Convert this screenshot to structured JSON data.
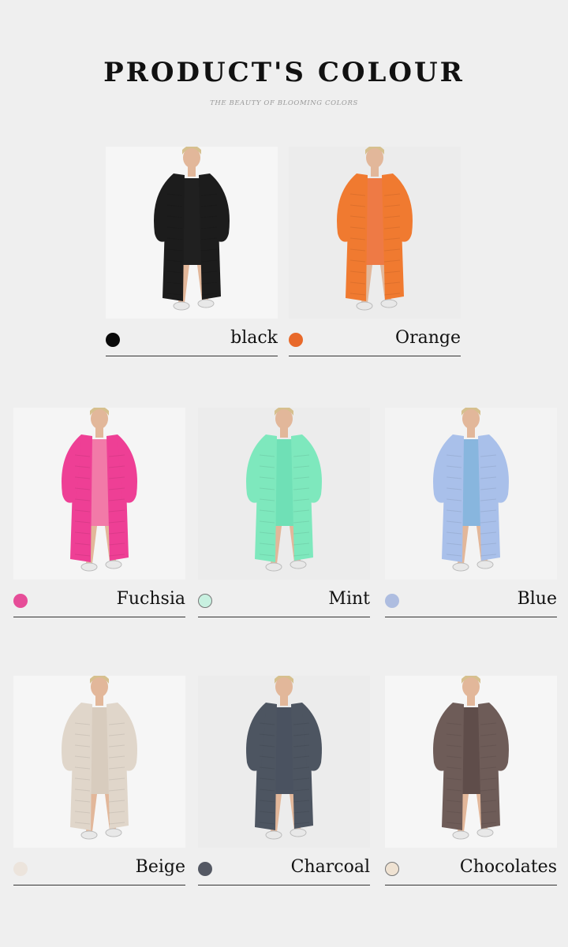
{
  "header": {
    "title": "PRODUCT'S COLOUR",
    "subtitle": "THE BEAUTY OF BLOOMING COLORS"
  },
  "colors": [
    {
      "name": "black",
      "swatch": "#0a0a0a",
      "garment": "#1c1c1c",
      "top": "#202020",
      "bg": "#f6f6f6"
    },
    {
      "name": "Orange",
      "swatch": "#e8692a",
      "garment": "#f07a30",
      "top": "#ee7a45",
      "bg": "#ececec"
    },
    {
      "name": "Fuchsia",
      "swatch": "#e64d98",
      "garment": "#ee3f95",
      "top": "#f27aa8",
      "bg": "#f5f5f5"
    },
    {
      "name": "Mint",
      "swatch": "#c8f0e0",
      "garment": "#7ee8bd",
      "top": "#6fe0b6",
      "bg": "#ececec"
    },
    {
      "name": "Blue",
      "swatch": "#aebde0",
      "garment": "#a9c0ea",
      "top": "#88b6de",
      "bg": "#f3f3f3"
    },
    {
      "name": "Beige",
      "swatch": "#ece4dc",
      "garment": "#e0d6ca",
      "top": "#d8ccbe",
      "bg": "#f6f6f6"
    },
    {
      "name": "Charcoal",
      "swatch": "#545863",
      "garment": "#4d5561",
      "top": "#4a5260",
      "bg": "#ececec"
    },
    {
      "name": "Chocolates",
      "swatch": "#efe2d2",
      "garment": "#6e5c58",
      "top": "#5f4d4a",
      "bg": "#f6f6f6"
    }
  ]
}
